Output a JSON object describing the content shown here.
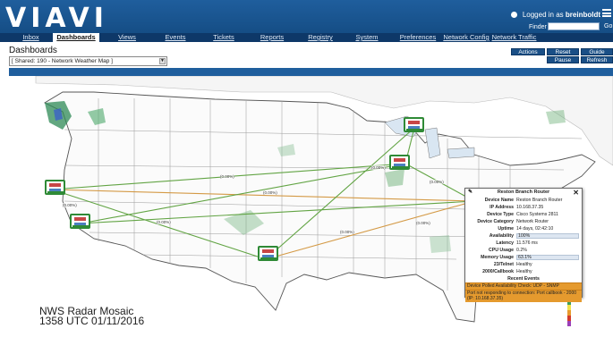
{
  "header": {
    "logo_text": "VIAVI",
    "logged_in_prefix": "Logged in as",
    "username": "breinboldt",
    "finder_label": "Finder",
    "finder_go": "Go"
  },
  "nav": {
    "tabs": [
      {
        "label": "Inbox"
      },
      {
        "label": "Dashboards"
      },
      {
        "label": "Views"
      },
      {
        "label": "Events"
      },
      {
        "label": "Tickets"
      },
      {
        "label": "Reports"
      },
      {
        "label": "Registry"
      },
      {
        "label": "System"
      },
      {
        "label": "Preferences"
      },
      {
        "label": "Network Config"
      },
      {
        "label": "Network Traffic"
      }
    ]
  },
  "page": {
    "title": "Dashboards",
    "dashboard_selector": "[ Shared: 190 - Network Weather Map ]"
  },
  "controls": {
    "actions": "Actions",
    "reset": "Reset",
    "guide": "Guide",
    "pause": "Pause",
    "refresh": "Refresh"
  },
  "map": {
    "caption_line1": "NWS Radar Mosaic",
    "caption_line2": "1358 UTC 01/11/2016",
    "link_labels": [
      "(0.00%)",
      "(0.00%)",
      "(0.00%)",
      "(0.00%)",
      "(0.00%)",
      "(0.00%)",
      "(0.00%)",
      "(0.00%)"
    ]
  },
  "popup": {
    "title": "Reston Branch Router",
    "rows": [
      {
        "key": "Device Name",
        "value": "Reston Branch Router"
      },
      {
        "key": "IP Address",
        "value": "10.168.37.35"
      },
      {
        "key": "Device Type",
        "value": "Cisco Systems 2811"
      },
      {
        "key": "Device Category",
        "value": "Network Router"
      },
      {
        "key": "Uptime",
        "value": "14 days, 02:42:10"
      }
    ],
    "availability": {
      "key": "Availability",
      "value": "100%",
      "fraction": 1.0
    },
    "latency": {
      "key": "Latency",
      "value": "11.576 ms"
    },
    "cpu": {
      "key": "CPU Usage",
      "value": "0.2%"
    },
    "memory": {
      "key": "Memory Usage",
      "value": "63.1%",
      "fraction": 0.631
    },
    "telnet": {
      "key": "23/Telnet",
      "value": "Healthy"
    },
    "callbook": {
      "key": "2000/Callbook",
      "value": "Healthy"
    },
    "events_title": "Recent Events",
    "events": [
      "Device Polled Availability Check: UDP - SNMP",
      "Port not responding to connection: Port callbook - 2000 (IP: 10.168.37.35)"
    ]
  },
  "colors": {
    "header_blue": "#1f5e9d",
    "nav_dark": "#0e3868",
    "node_green": "#2f8a36",
    "event_orange": "#e59a2e"
  }
}
